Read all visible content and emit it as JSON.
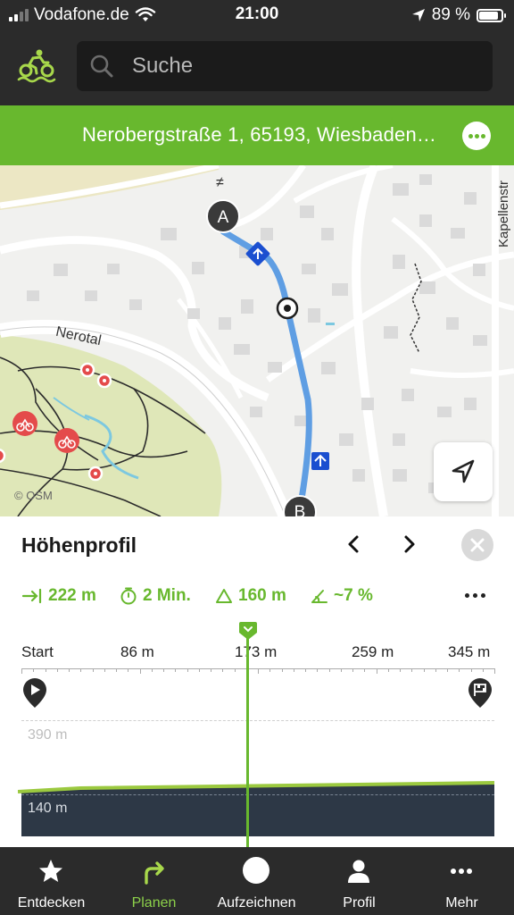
{
  "status_bar": {
    "carrier": "Vodafone.de",
    "time": "21:00",
    "battery": "89 %",
    "battery_level": 0.89
  },
  "header": {
    "logo_icon": "bike-logo-icon",
    "search_placeholder": "Suche"
  },
  "route": {
    "address": "Nerobergstraße 1, 65193, Wiesbaden…"
  },
  "map": {
    "attribution": "© OSM",
    "streets": [
      "Nerotal",
      "Kapellenstr"
    ],
    "markers": [
      "B",
      "A"
    ],
    "route_color": "#5f9ee3"
  },
  "elevation_panel": {
    "title": "Höhenprofil",
    "stats": {
      "distance": "222 m",
      "duration": "2 Min.",
      "climb": "160 m",
      "gradient": "~7 %"
    },
    "axis_labels": [
      "Start",
      "86 m",
      "173 m",
      "259 m",
      "345 m"
    ],
    "elevation_max_label": "390 m",
    "elevation_min_label": "140 m",
    "cursor_fraction": 0.5
  },
  "colors": {
    "accent": "#68b82e",
    "bar": "#2b2b2b",
    "profile_fill": "#2d3846"
  },
  "tabbar": {
    "tabs": [
      {
        "label": "Entdecken",
        "icon": "star-icon"
      },
      {
        "label": "Planen",
        "icon": "route-arrow-icon",
        "active": true
      },
      {
        "label": "Aufzeichnen",
        "icon": "record-icon"
      },
      {
        "label": "Profil",
        "icon": "person-icon"
      },
      {
        "label": "Mehr",
        "icon": "more-dots-icon"
      }
    ]
  }
}
